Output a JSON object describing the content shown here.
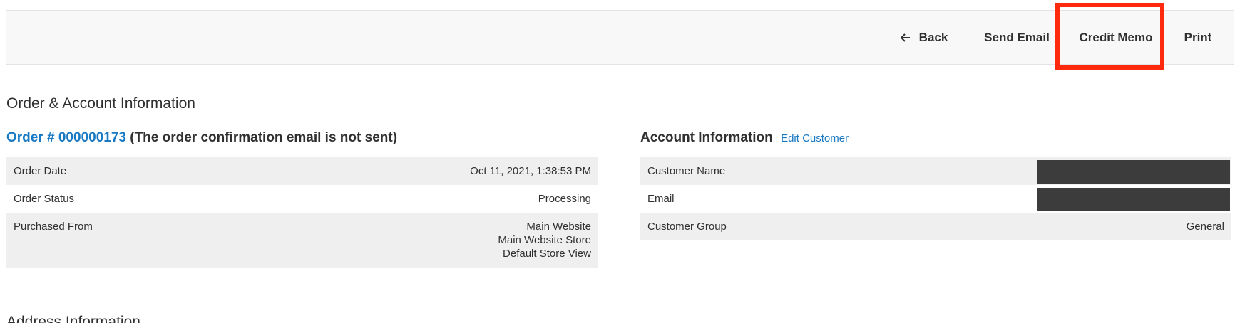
{
  "toolbar": {
    "back_label": "Back",
    "send_email_label": "Send Email",
    "credit_memo_label": "Credit Memo",
    "print_label": "Print"
  },
  "section": {
    "title": "Order & Account Information"
  },
  "order": {
    "number_label": "Order # 000000173",
    "email_note": "(The order confirmation email is not sent)",
    "rows": [
      {
        "label": "Order Date",
        "value": "Oct 11, 2021, 1:38:53 PM"
      },
      {
        "label": "Order Status",
        "value": "Processing"
      },
      {
        "label": "Purchased From",
        "values": [
          "Main Website",
          "Main Website Store",
          "Default Store View"
        ]
      }
    ]
  },
  "account": {
    "title": "Account Information",
    "edit_link": "Edit Customer",
    "rows": [
      {
        "label": "Customer Name",
        "value": ""
      },
      {
        "label": "Email",
        "value": ""
      },
      {
        "label": "Customer Group",
        "value": "General"
      }
    ]
  },
  "address": {
    "title": "Address Information"
  },
  "colors": {
    "link": "#1979c3",
    "highlight": "#ff2a0d",
    "row_shade": "#efefef",
    "toolbar_bg": "#f8f8f8",
    "redaction": "#3c3c3c"
  }
}
